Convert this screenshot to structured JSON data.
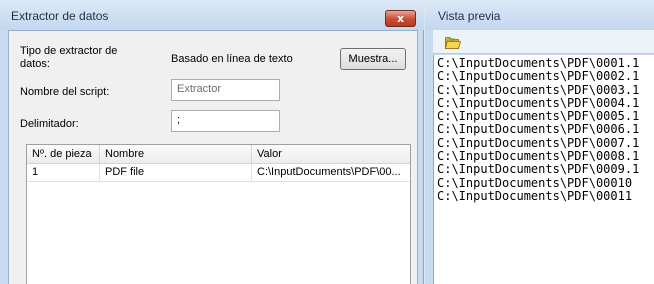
{
  "dialog": {
    "title": "Extractor de datos",
    "close_glyph": "x",
    "type_label": "Tipo de extractor de datos:",
    "type_value": "Basado en línea de texto",
    "sample_button": "Muestra...",
    "script_name_label": "Nombre del script:",
    "script_name_placeholder": "Extractor",
    "delimiter_label": "Delimitador:",
    "delimiter_value": ";",
    "table": {
      "columns": [
        "Nº. de pieza",
        "Nombre",
        "Valor"
      ],
      "rows": [
        [
          "1",
          "PDF file",
          "C:\\InputDocuments\\PDF\\00..."
        ]
      ]
    }
  },
  "preview": {
    "title": "Vista previa",
    "toolbar_icon": "folder-open-icon",
    "lines": [
      "C:\\InputDocuments\\PDF\\0001.1",
      "C:\\InputDocuments\\PDF\\0002.1",
      "C:\\InputDocuments\\PDF\\0003.1",
      "C:\\InputDocuments\\PDF\\0004.1",
      "C:\\InputDocuments\\PDF\\0005.1",
      "C:\\InputDocuments\\PDF\\0006.1",
      "C:\\InputDocuments\\PDF\\0007.1",
      "C:\\InputDocuments\\PDF\\0008.1",
      "C:\\InputDocuments\\PDF\\0009.1",
      "C:\\InputDocuments\\PDF\\00010",
      "C:\\InputDocuments\\PDF\\00011"
    ]
  },
  "colors": {
    "chrome": "#c9dbef",
    "close_button": "#c94d34",
    "folder": "#e8c431"
  }
}
